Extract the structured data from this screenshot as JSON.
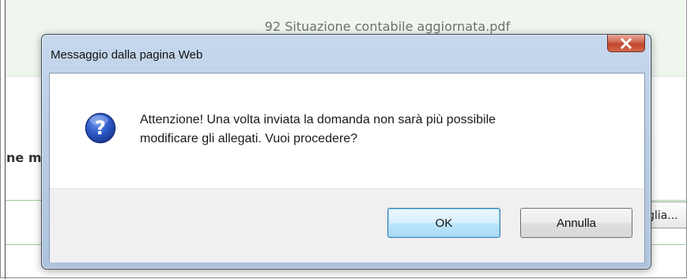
{
  "background": {
    "filename": "92 Situazione contabile aggiornata.pdf",
    "partial_heading": "ne m",
    "partial_button": "glia..."
  },
  "dialog": {
    "title": "Messaggio dalla pagina Web",
    "close_icon": "close-x-icon",
    "icon": "question-icon",
    "message_line1": "Attenzione! Una volta inviata la domanda non sarà più possibile",
    "message_line2": "modificare gli allegati. Vuoi procedere?",
    "ok_label": "OK",
    "cancel_label": "Annulla"
  },
  "colors": {
    "banner": "#eef6ee",
    "frame": "#b9cde4",
    "close_button": "#c0452d",
    "question_icon": "#2a4fb8"
  }
}
